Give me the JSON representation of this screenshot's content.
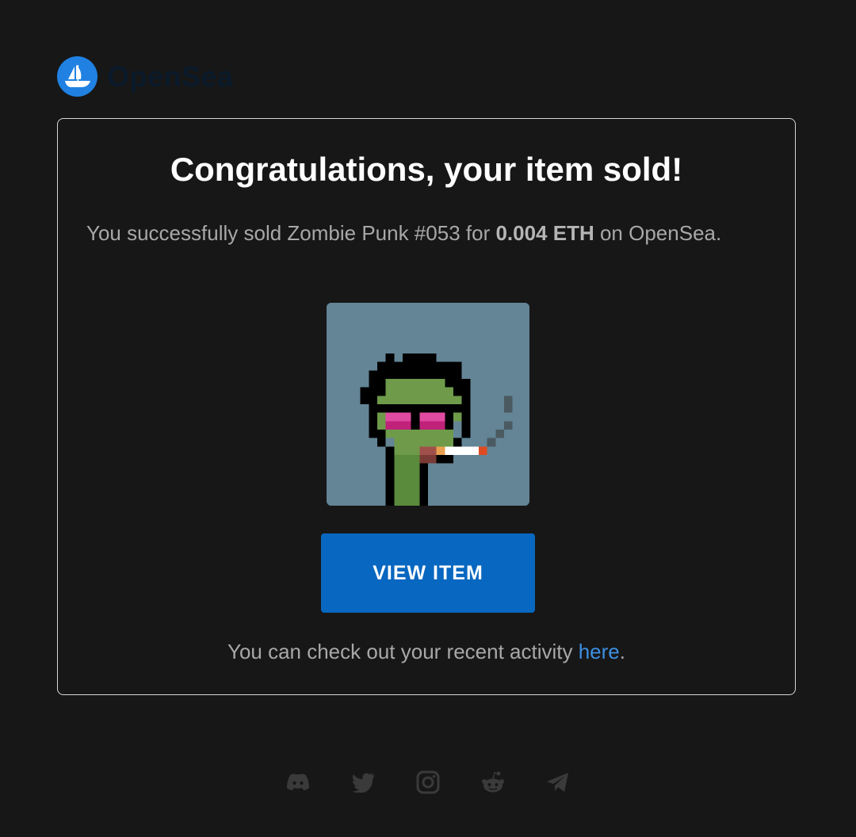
{
  "brand": {
    "name": "OpenSea",
    "logo_color": "#2081e2"
  },
  "email": {
    "headline": "Congratulations, your item sold!",
    "message_prefix": "You successfully sold ",
    "item_name": "Zombie Punk #053",
    "message_mid": " for ",
    "price": "0.004 ETH",
    "message_suffix": " on OpenSea.",
    "image_background": "#638596",
    "button_label": "VIEW ITEM",
    "button_color": "#0867c0",
    "activity_prefix": "You can check out your recent activity ",
    "activity_link": "here",
    "activity_suffix": "."
  },
  "social": {
    "icons": [
      "discord-icon",
      "twitter-icon",
      "instagram-icon",
      "reddit-icon",
      "telegram-icon"
    ],
    "icon_color": "#3a3a3a"
  }
}
